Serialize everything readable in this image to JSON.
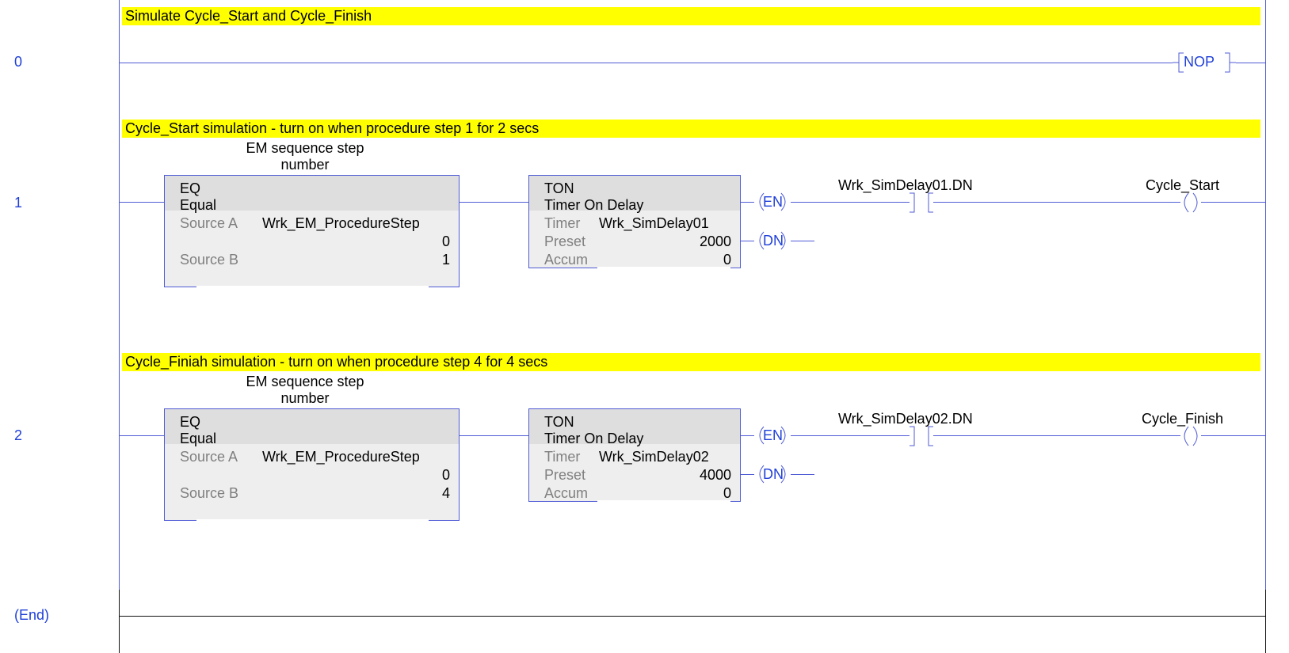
{
  "rungs": [
    {
      "number": "0",
      "comment": "Simulate Cycle_Start and Cycle_Finish",
      "output": "NOP"
    },
    {
      "number": "1",
      "comment": "Cycle_Start simulation - turn on when procedure step 1 for 2 secs",
      "eq": {
        "desc_line1": "EM sequence step",
        "desc_line2": "number",
        "mnemonic": "EQ",
        "title": "Equal",
        "source_a_label": "Source A",
        "source_a_tag": "Wrk_EM_ProcedureStep",
        "source_a_value": "0",
        "source_b_label": "Source B",
        "source_b_value": "1"
      },
      "ton": {
        "mnemonic": "TON",
        "title": "Timer On Delay",
        "timer_label": "Timer",
        "timer_tag": "Wrk_SimDelay01",
        "preset_label": "Preset",
        "preset_value": "2000",
        "accum_label": "Accum",
        "accum_value": "0"
      },
      "en": "EN",
      "dn": "DN",
      "contact_tag": "Wrk_SimDelay01.DN",
      "coil_tag": "Cycle_Start"
    },
    {
      "number": "2",
      "comment": "Cycle_Finiah simulation - turn on when procedure step 4 for 4 secs",
      "eq": {
        "desc_line1": "EM sequence step",
        "desc_line2": "number",
        "mnemonic": "EQ",
        "title": "Equal",
        "source_a_label": "Source A",
        "source_a_tag": "Wrk_EM_ProcedureStep",
        "source_a_value": "0",
        "source_b_label": "Source B",
        "source_b_value": "4"
      },
      "ton": {
        "mnemonic": "TON",
        "title": "Timer On Delay",
        "timer_label": "Timer",
        "timer_tag": "Wrk_SimDelay02",
        "preset_label": "Preset",
        "preset_value": "4000",
        "accum_label": "Accum",
        "accum_value": "0"
      },
      "en": "EN",
      "dn": "DN",
      "contact_tag": "Wrk_SimDelay02.DN",
      "coil_tag": "Cycle_Finish"
    }
  ],
  "end_label": "(End)",
  "colors": {
    "rung_line": "#4f5bd5",
    "comment_bg": "#ffff00",
    "instruction_text": "#1f3fd8",
    "block_bg": "#eeeeee",
    "block_header_bg": "#dedede"
  }
}
